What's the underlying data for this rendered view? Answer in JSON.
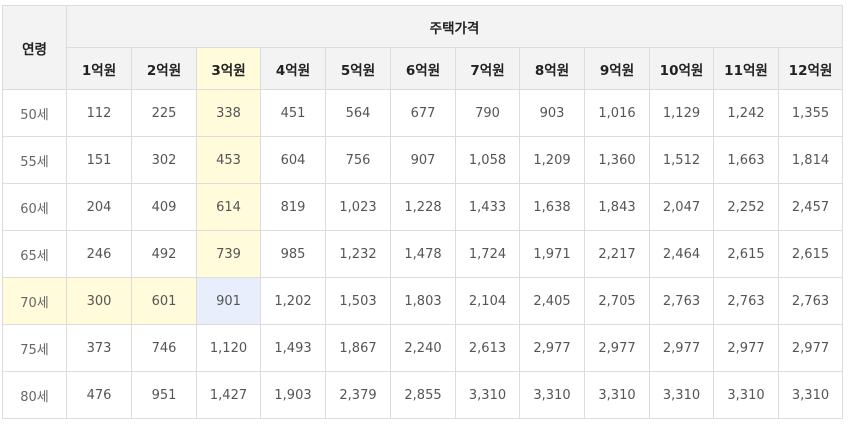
{
  "table": {
    "age_header": "연령",
    "group_header": "주택가격",
    "price_columns": [
      "1억원",
      "2억원",
      "3억원",
      "4억원",
      "5억원",
      "6억원",
      "7억원",
      "8억원",
      "9억원",
      "10억원",
      "11억원",
      "12억원"
    ],
    "rows": [
      {
        "age": "50세",
        "values": [
          "112",
          "225",
          "338",
          "451",
          "564",
          "677",
          "790",
          "903",
          "1,016",
          "1,129",
          "1,242",
          "1,355"
        ]
      },
      {
        "age": "55세",
        "values": [
          "151",
          "302",
          "453",
          "604",
          "756",
          "907",
          "1,058",
          "1,209",
          "1,360",
          "1,512",
          "1,663",
          "1,814"
        ]
      },
      {
        "age": "60세",
        "values": [
          "204",
          "409",
          "614",
          "819",
          "1,023",
          "1,228",
          "1,433",
          "1,638",
          "1,843",
          "2,047",
          "2,252",
          "2,457"
        ]
      },
      {
        "age": "65세",
        "values": [
          "246",
          "492",
          "739",
          "985",
          "1,232",
          "1,478",
          "1,724",
          "1,971",
          "2,217",
          "2,464",
          "2,615",
          "2,615"
        ]
      },
      {
        "age": "70세",
        "values": [
          "300",
          "601",
          "901",
          "1,202",
          "1,503",
          "1,803",
          "2,104",
          "2,405",
          "2,705",
          "2,763",
          "2,763",
          "2,763"
        ]
      },
      {
        "age": "75세",
        "values": [
          "373",
          "746",
          "1,120",
          "1,493",
          "1,867",
          "2,240",
          "2,613",
          "2,977",
          "2,977",
          "2,977",
          "2,977",
          "2,977"
        ]
      },
      {
        "age": "80세",
        "values": [
          "476",
          "951",
          "1,427",
          "1,903",
          "2,379",
          "2,855",
          "3,310",
          "3,310",
          "3,310",
          "3,310",
          "3,310",
          "3,310"
        ]
      }
    ],
    "highlight": {
      "yellow": "#fffbdb",
      "blue": "#e8eefc",
      "highlighted_column": "3억원",
      "highlighted_row": "70세",
      "intersection": "70세 / 3억원"
    }
  }
}
